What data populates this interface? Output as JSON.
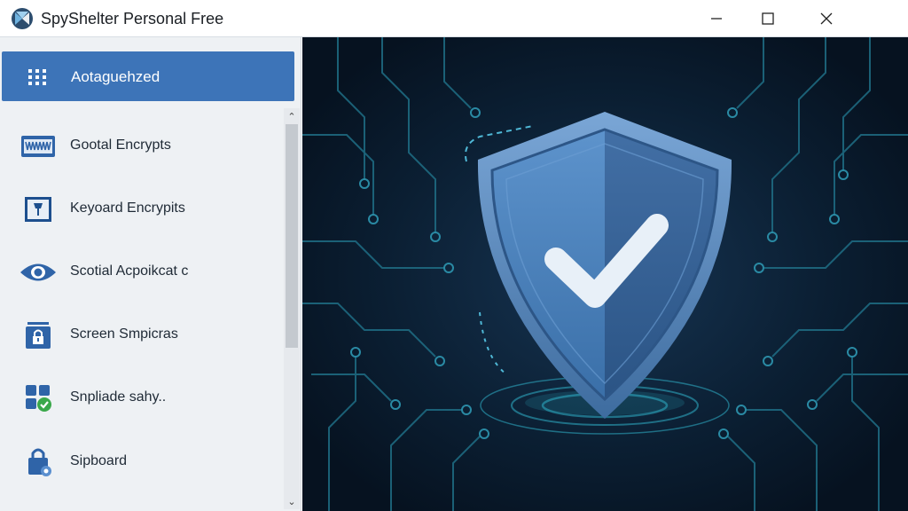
{
  "window": {
    "title": "SpyShelter Personal Free",
    "logo_icon": "spyshelter-logo-icon",
    "controls": [
      "minimize-icon",
      "maximize-icon",
      "close-icon"
    ]
  },
  "sidebar": {
    "header": {
      "label": "Aotaguehzed",
      "icon": "grid-icon"
    },
    "items": [
      {
        "label": "Gootal Encrypts",
        "icon": "keyboard-icon"
      },
      {
        "label": "Keyoard Encrypits",
        "icon": "window-icon"
      },
      {
        "label": "Scotial Acpoikcat c",
        "icon": "eye-icon"
      },
      {
        "label": "Screen Smpicras",
        "icon": "lock-screen-icon"
      },
      {
        "label": "Snpliade sahy..",
        "icon": "apps-check-icon"
      },
      {
        "label": "Sipboard",
        "icon": "clipboard-lock-icon"
      }
    ]
  },
  "hero": {
    "icon": "shield-check-icon",
    "theme_colors": {
      "background": "#07131f",
      "circuit": "#1d6f86",
      "shield": "#4a7fb8",
      "accent": "#3d74b8"
    }
  }
}
